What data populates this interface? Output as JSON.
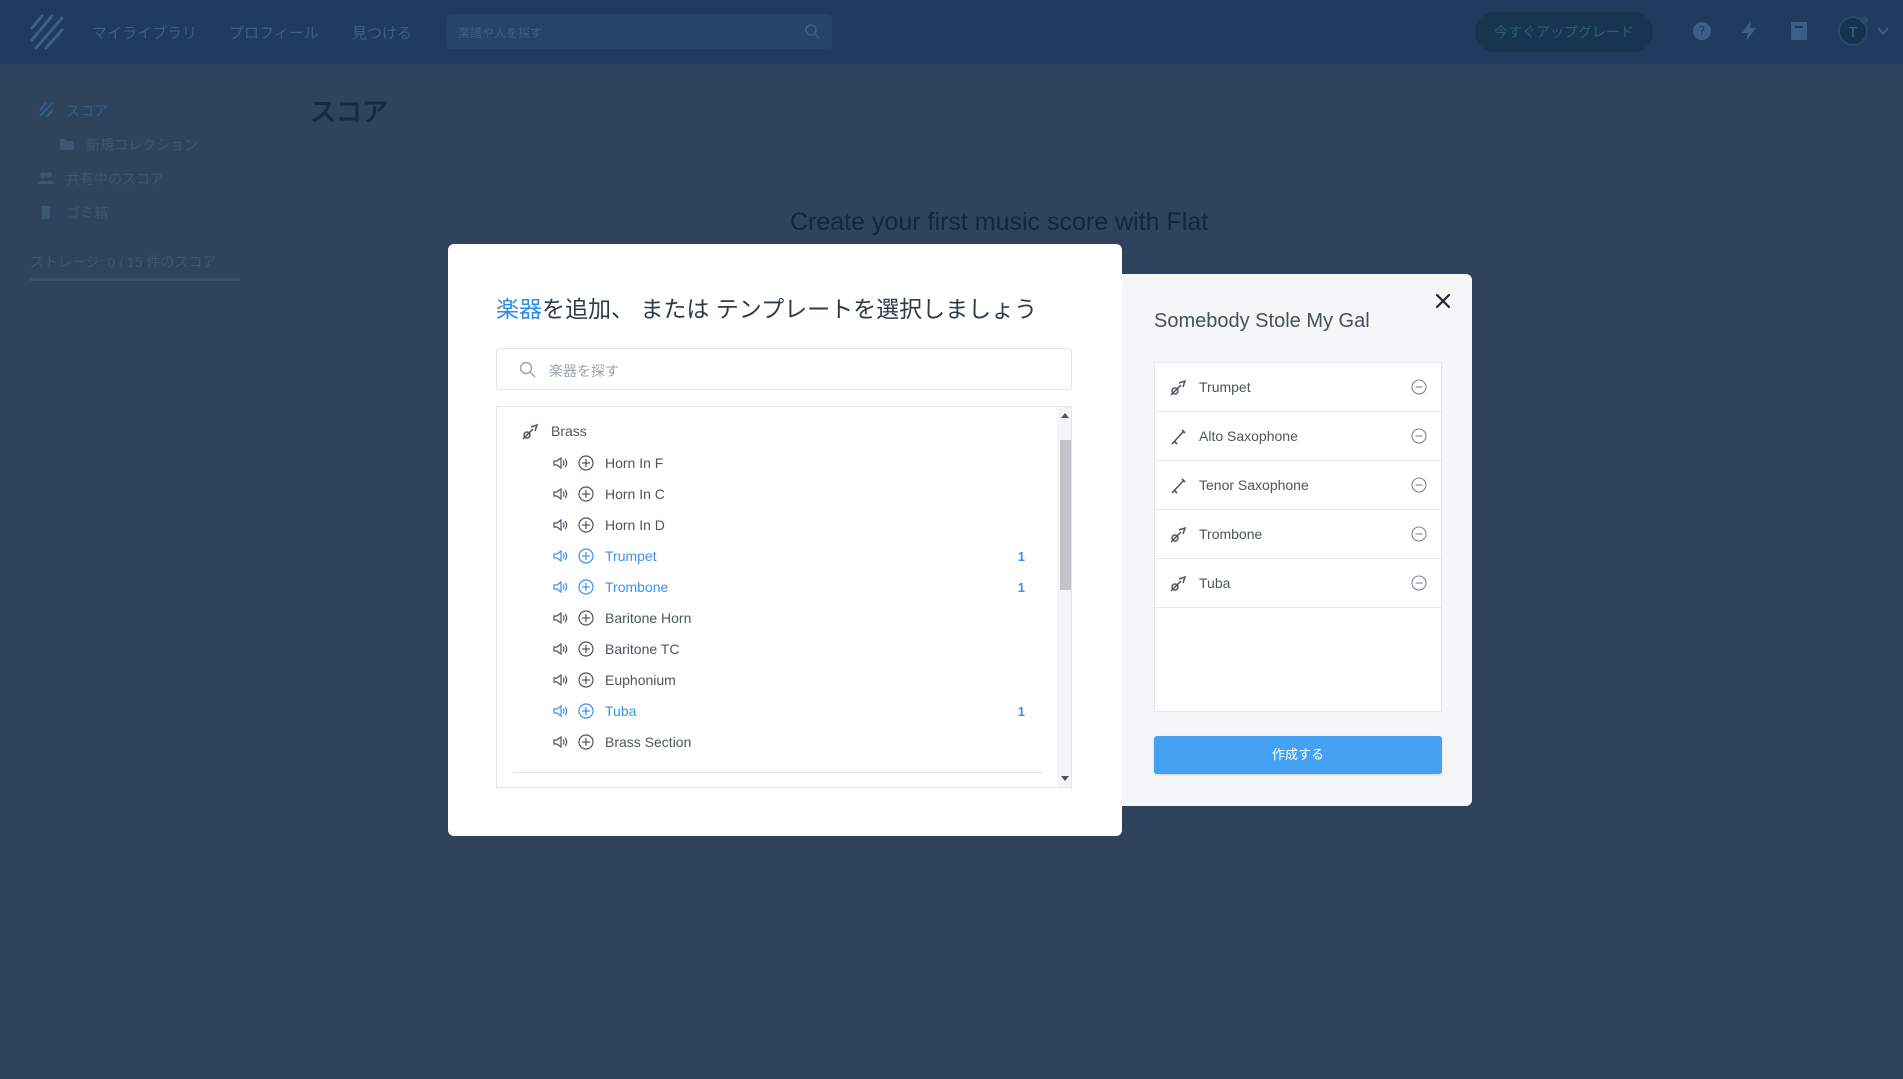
{
  "nav": {
    "links": [
      "マイライブラリ",
      "プロフィール",
      "見つける"
    ],
    "search_placeholder": "楽譜や人を探す",
    "upgrade_label": "今すぐアップグレード",
    "avatar_letter": "T"
  },
  "sidebar": {
    "scores": "スコア",
    "new_collection": "新規コレクション",
    "shared": "共有中のスコア",
    "trash": "ゴミ箱",
    "storage": "ストレージ: 0 / 15 件のスコア"
  },
  "page": {
    "title": "スコア",
    "hero": "Create your first music score with Flat"
  },
  "add_dialog": {
    "title_highlight": "楽器",
    "title_middle": "を追加、 または ",
    "title_template": "テンプレート",
    "title_end": "を選択しましょう",
    "search_placeholder": "楽器を探す",
    "category": "Brass",
    "instruments": [
      {
        "name": "Horn In F",
        "count": ""
      },
      {
        "name": "Horn In C",
        "count": ""
      },
      {
        "name": "Horn In D",
        "count": ""
      },
      {
        "name": "Trumpet",
        "count": "1"
      },
      {
        "name": "Trombone",
        "count": "1"
      },
      {
        "name": "Baritone Horn",
        "count": ""
      },
      {
        "name": "Baritone TC",
        "count": ""
      },
      {
        "name": "Euphonium",
        "count": ""
      },
      {
        "name": "Tuba",
        "count": "1"
      },
      {
        "name": "Brass Section",
        "count": ""
      }
    ]
  },
  "score_panel": {
    "title": "Somebody Stole My Gal",
    "selected": [
      "Trumpet",
      "Alto Saxophone",
      "Tenor Saxophone",
      "Trombone",
      "Tuba"
    ],
    "create_label": "作成する"
  },
  "colors": {
    "accent": "#2f8ce6",
    "selected_text": "#3a93e8",
    "button": "#45a2f2",
    "overlay_bg": "#30435c"
  }
}
